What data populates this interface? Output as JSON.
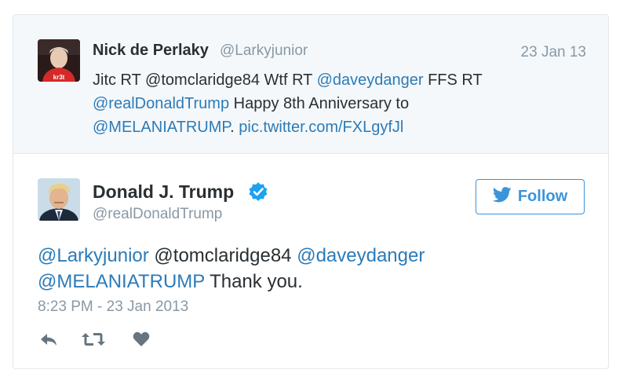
{
  "quoted": {
    "name": "Nick de Perlaky",
    "handle": "@Larkyjunior",
    "date": "23 Jan 13",
    "text": {
      "p1": "Jitc RT @tomclaridge84 Wtf RT ",
      "m1": "@daveydanger",
      "p2": " FFS RT ",
      "m2": "@realDonaldTrump",
      "p3": " Happy 8th Anniversary to ",
      "m3": "@MELANIATRUMP",
      "p4": ". ",
      "link": "pic.twitter.com/FXLgyfJl"
    },
    "avatar_jersey_text": "kr3t"
  },
  "tweet": {
    "name": "Donald J. Trump",
    "handle": "@realDonaldTrump",
    "follow_label": "Follow",
    "text": {
      "m1": "@Larkyjunior",
      "p1": " @tomclaridge84 ",
      "m2": "@daveydanger",
      "m3": "@MELANIATRUMP",
      "p2": " Thank you."
    },
    "timestamp": "8:23 PM - 23 Jan 2013"
  },
  "icons": {
    "reply": "reply-icon",
    "retweet": "retweet-icon",
    "like": "heart-icon",
    "verified": "verified-badge-icon",
    "bird": "twitter-bird-icon"
  },
  "colors": {
    "link": "#2b7bb9",
    "follow": "#3b94d9",
    "muted": "#8899a6",
    "quoted_bg": "#f5f8fa",
    "verified": "#1da1f2",
    "action_icon": "#66757f"
  }
}
